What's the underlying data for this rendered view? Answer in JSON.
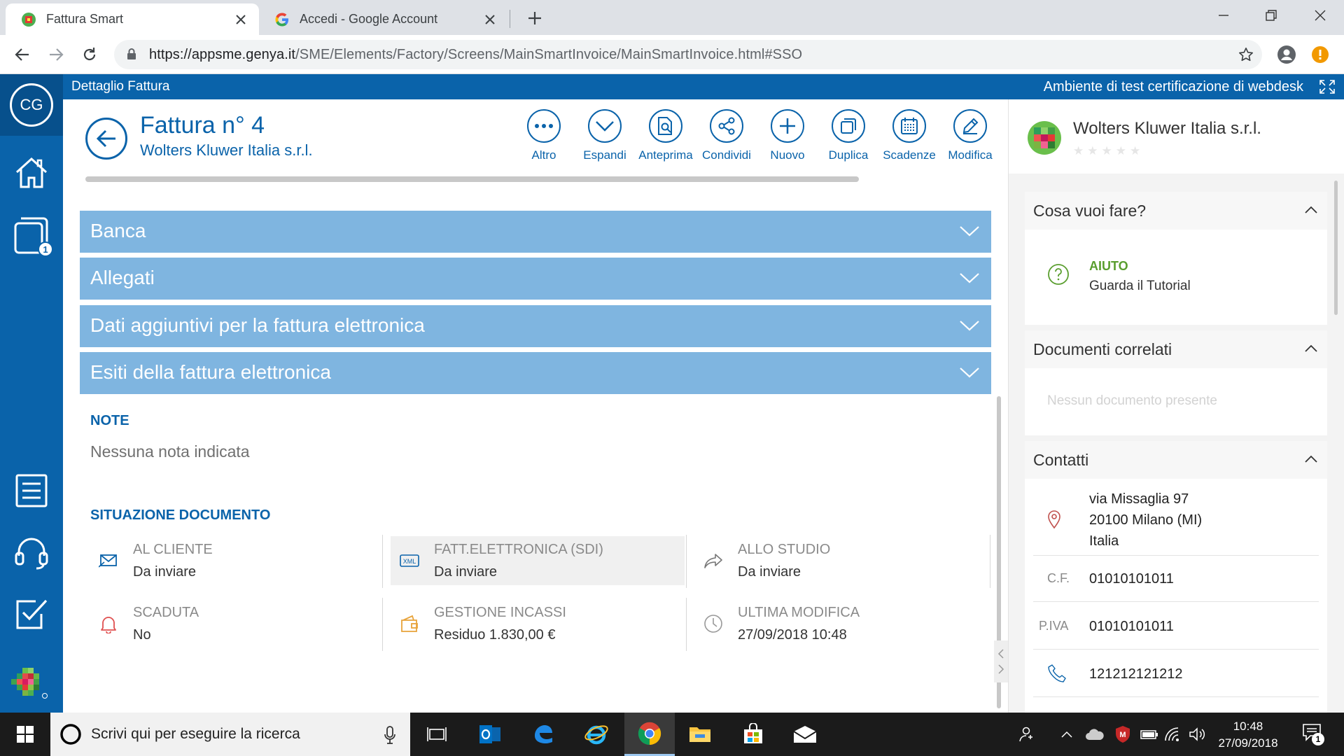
{
  "browser": {
    "tabs": [
      {
        "title": "Fattura Smart",
        "active": true
      },
      {
        "title": "Accedi - Google Account",
        "active": false
      }
    ],
    "url_host": "https://appsme.genya.it",
    "url_path": "/SME/Elements/Factory/Screens/MainSmartInvoice/MainSmartInvoice.html#SSO"
  },
  "app_header": {
    "left": "Dettaglio Fattura",
    "right": "Ambiente di test certificazione di webdesk"
  },
  "sidebar": {
    "avatar_initials": "CG",
    "badge": "1"
  },
  "document": {
    "title": "Fattura n° 4",
    "customer": "Wolters Kluwer Italia s.r.l."
  },
  "actions": [
    "Altro",
    "Espandi",
    "Anteprima",
    "Condividi",
    "Nuovo",
    "Duplica",
    "Scadenze",
    "Modifica"
  ],
  "sections": [
    "Banca",
    "Allegati",
    "Dati aggiuntivi per la fattura elettronica",
    "Esiti della fattura elettronica"
  ],
  "note": {
    "title": "NOTE",
    "text": "Nessuna nota indicata"
  },
  "situation": {
    "title": "SITUAZIONE DOCUMENTO",
    "items": [
      {
        "label": "AL CLIENTE",
        "value": "Da inviare",
        "icon": "envelope-icon"
      },
      {
        "label": "FATT.ELETTRONICA (SDI)",
        "value": "Da inviare",
        "icon": "xml-icon"
      },
      {
        "label": "ALLO STUDIO",
        "value": "Da inviare",
        "icon": "share-arrow-icon"
      },
      {
        "label": "SCADUTA",
        "value": "No",
        "icon": "bell-icon"
      },
      {
        "label": "GESTIONE INCASSI",
        "value": "Residuo 1.830,00 €",
        "icon": "wallet-icon"
      },
      {
        "label": "ULTIMA MODIFICA",
        "value": "27/09/2018 10:48",
        "icon": "clock-icon"
      }
    ]
  },
  "right_panel": {
    "company": "Wolters Kluwer Italia s.r.l.",
    "stars": "★★★★★",
    "what_to_do": {
      "title": "Cosa vuoi fare?",
      "help_title": "AIUTO",
      "help_text": "Guarda il Tutorial"
    },
    "related": {
      "title": "Documenti correlati",
      "empty": "Nessun documento presente"
    },
    "contacts": {
      "title": "Contatti",
      "address_1": "via Missaglia 97",
      "address_2": "20100 Milano (MI)",
      "address_3": "Italia",
      "cf_label": "C.F.",
      "cf": "01010101011",
      "piva_label": "P.IVA",
      "piva": "01010101011",
      "phone": "121212121212"
    }
  },
  "taskbar": {
    "search_placeholder": "Scrivi qui per eseguire la ricerca",
    "time": "10:48",
    "date": "27/09/2018",
    "notifications": "1"
  },
  "colors": {
    "brand_blue": "#0a63aa",
    "accordion_blue": "#7fb5e0",
    "help_green": "#5a9e2f"
  }
}
